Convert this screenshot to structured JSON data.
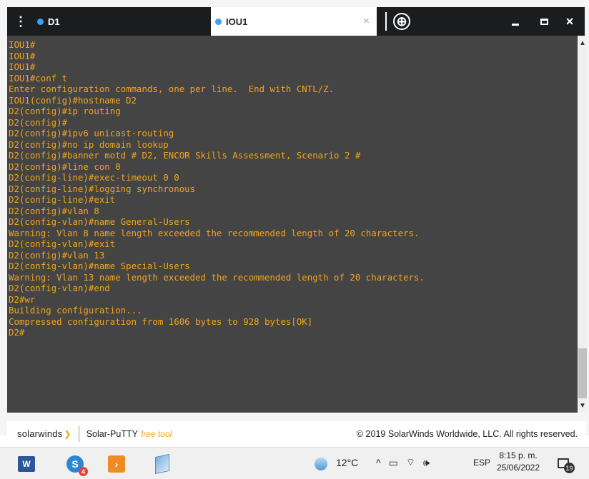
{
  "tabs": [
    {
      "label": "D1",
      "active": false
    },
    {
      "label": "IOU1",
      "active": true
    }
  ],
  "icons": {
    "menu": "vertical-dots-icon",
    "tab_close": "×",
    "new_tab": "⊕",
    "close_window": "×"
  },
  "terminal": {
    "lines": [
      "IOU1#",
      "IOU1#",
      "IOU1#",
      "IOU1#conf t",
      "Enter configuration commands, one per line.  End with CNTL/Z.",
      "IOU1(config)#hostname D2",
      "D2(config)#ip routing",
      "D2(config)#",
      "D2(config)#ipv6 unicast-routing",
      "D2(config)#no ip domain lookup",
      "D2(config)#banner motd # D2, ENCOR Skills Assessment, Scenario 2 #",
      "D2(config)#line con 0",
      "D2(config-line)#exec-timeout 0 0",
      "D2(config-line)#logging synchronous",
      "D2(config-line)#exit",
      "D2(config)#vlan 8",
      "D2(config-vlan)#name General-Users",
      "Warning: Vlan 8 name length exceeded the recommended length of 20 characters.",
      "D2(config-vlan)#exit",
      "D2(config)#vlan 13",
      "D2(config-vlan)#name Special-Users",
      "Warning: Vlan 13 name length exceeded the recommended length of 20 characters.",
      "D2(config-vlan)#end",
      "D2#wr",
      "Building configuration...",
      "Compressed configuration from 1606 bytes to 928 bytes[OK]",
      "D2#"
    ],
    "text_color": "#f2a51c",
    "background": "#444444"
  },
  "footer": {
    "brand": "solarwinds",
    "product": "Solar-PuTTY",
    "free_label": "free tool",
    "copyright": "© 2019 SolarWinds Worldwide, LLC. All rights reserved."
  },
  "taskbar": {
    "apps": [
      "word-icon",
      "skype-icon",
      "solar-putty-icon",
      "sticky-notes-icon"
    ],
    "skype_badge": "4",
    "temperature": "12°C",
    "tray_symbols": {
      "chevron": "^",
      "network": "▭",
      "wifi": "⌔",
      "volume": "🕪"
    },
    "language": "ESP",
    "time": "8:15 p. m.",
    "date": "25/06/2022",
    "notifications": "19"
  }
}
